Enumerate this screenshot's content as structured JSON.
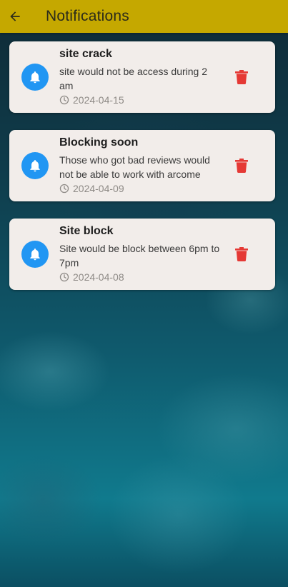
{
  "appbar": {
    "title": "Notifications",
    "back_icon": "arrow-left-icon",
    "color": "#c5a800"
  },
  "notifications": [
    {
      "title": "site crack",
      "message": "site would not be access during 2 am",
      "date": "2024-04-15",
      "icon": "bell-icon",
      "action_icon": "trash-icon"
    },
    {
      "title": "Blocking soon",
      "message": "Those who got bad reviews would not be able to work with arcome",
      "date": "2024-04-09",
      "icon": "bell-icon",
      "action_icon": "trash-icon"
    },
    {
      "title": "Site block",
      "message": "Site would be block between 6pm to 7pm",
      "date": "2024-04-08",
      "icon": "bell-icon",
      "action_icon": "trash-icon"
    }
  ],
  "colors": {
    "bell_circle": "#2196f3",
    "delete": "#e53935",
    "card_bg": "#f2edea"
  }
}
